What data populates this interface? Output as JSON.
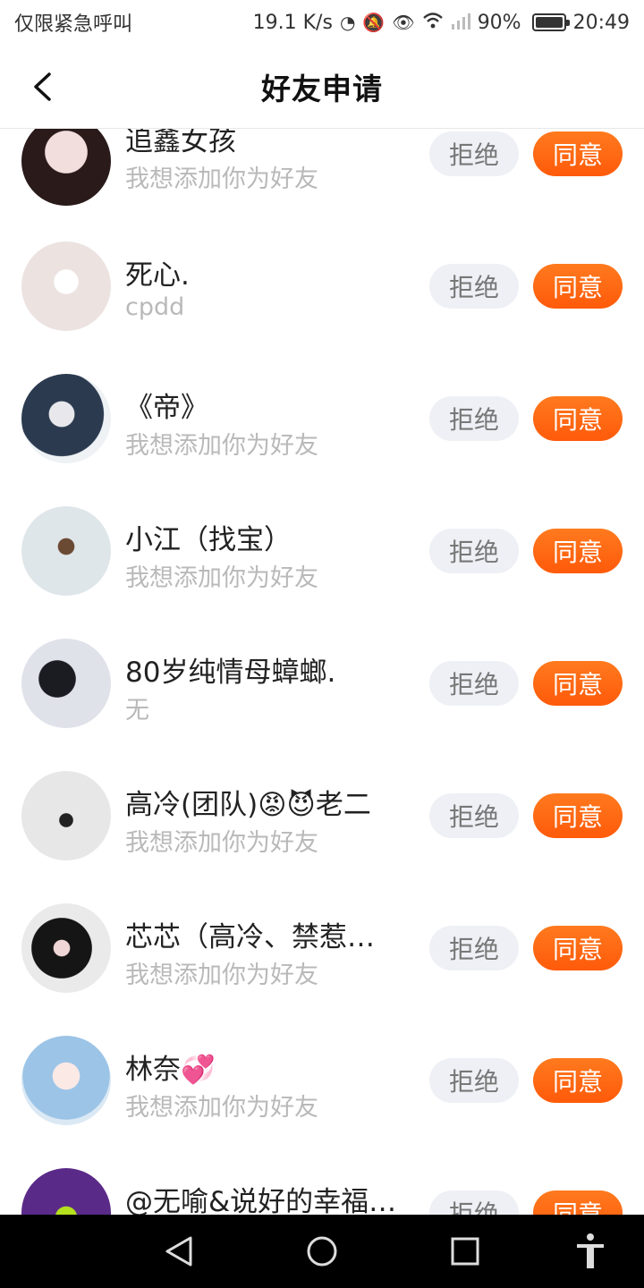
{
  "status": {
    "carrier": "仅限紧急呼叫",
    "speed": "19.1 K/s",
    "battery": "90%",
    "time": "20:49"
  },
  "header": {
    "title": "好友申请"
  },
  "requests": [
    {
      "name": "追鑫女孩",
      "message": "我想添加你为好友"
    },
    {
      "name": "死心.",
      "message": "cpdd"
    },
    {
      "name": "《帝》",
      "message": "我想添加你为好友"
    },
    {
      "name": "小江（找宝）",
      "message": "我想添加你为好友"
    },
    {
      "name": "80岁纯情母蟑螂.",
      "message": "无"
    },
    {
      "name": "高冷(团队)😡😈老二",
      "message": "我想添加你为好友"
    },
    {
      "name": "芯芯（高冷、禁惹…",
      "message": "我想添加你为好友"
    },
    {
      "name": "林奈💞",
      "message": "我想添加你为好友"
    },
    {
      "name": "@无喻&说好的幸福…",
      "message": ""
    }
  ],
  "buttons": {
    "reject": "拒绝",
    "agree": "同意"
  },
  "colors": {
    "accent": "#ff6410",
    "reject_bg": "#eef0f5"
  }
}
